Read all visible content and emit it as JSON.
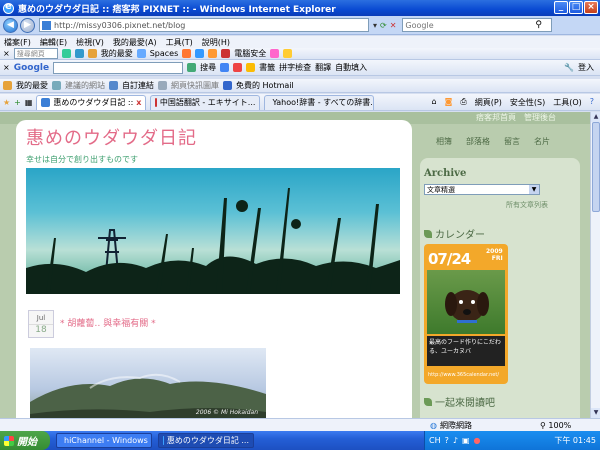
{
  "window": {
    "title": "惠めのウダウダ日記 :: 痞客邦 PIXNET :: - Windows Internet Explorer"
  },
  "address": {
    "url": "http://missy0306.pixnet.net/blog",
    "search_placeholder": "Google"
  },
  "menu": [
    "檔案(F)",
    "編輯(E)",
    "檢視(V)",
    "我的最愛(A)",
    "工具(T)",
    "說明(H)"
  ],
  "toolbar1": {
    "search_placeholder": "搜尋網頁",
    "favorites": "我的最愛",
    "spaces": "Spaces",
    "security": "電腦安全"
  },
  "toolbar2": {
    "google": "Google",
    "search": "搜尋",
    "bookmarks": "書籤",
    "spellcheck": "拼字檢查",
    "translate": "翻譯",
    "autofill": "自動填入",
    "signin": "登入"
  },
  "toolbar3": {
    "favorites": "我的最愛",
    "suggested": "建議的網站",
    "custom_links": "自訂連結",
    "web_slices": "網頁快訊圖庫",
    "hotmail": "免費的 Hotmail"
  },
  "tabs": [
    "惠めのウダウダ日記 ::",
    "中国語翻訳 - エキサイト...",
    "Yahoo!辞書 - すべての辞書..."
  ],
  "commands": [
    "網頁(P)",
    "安全性(S)",
    "工具(O)"
  ],
  "blog": {
    "top_links": [
      "痞客邦首頁",
      "管理後台"
    ],
    "title": "惠めのウダウダ日記",
    "subtitle": "幸せは自分で創り出すものです",
    "post": {
      "month": "Jul",
      "day": "18",
      "title": "* 胡蘿蔔‥ 與幸福有關 *",
      "photo_watermark": "2006 © Mi Hokaidan"
    }
  },
  "sidebar": {
    "nav": [
      "相簿",
      "部落格",
      "留言",
      "名片"
    ],
    "archive_heading": "Archive",
    "archive_select": "文章精選",
    "archive_link": "所有文章列表",
    "calendar_heading": "カレンダー",
    "calendar_date": "07/24",
    "calendar_year": "2009",
    "calendar_weekday": "FRI",
    "calendar_caption": "最高のフード作りにこだわる、ユーカヌバ",
    "calendar_url": "http://www.365calendar.net/",
    "reading_heading": "一起來閱讀吧"
  },
  "status": {
    "zone": "網際網路",
    "zoom": "100%"
  },
  "taskbar": {
    "start": "開始",
    "tasks": [
      "hiChannel - Windows ...",
      "惠めのウダウダ日記 ..."
    ],
    "ime": "CH",
    "clock": "下午 01:45"
  }
}
